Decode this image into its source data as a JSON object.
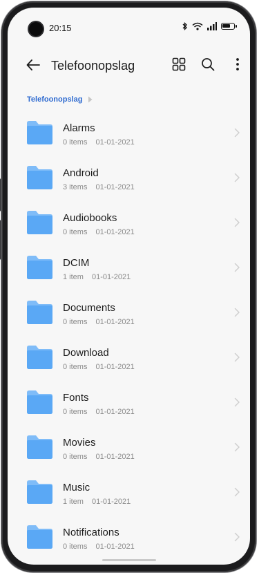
{
  "status_bar": {
    "time": "20:15",
    "icons": [
      "bluetooth-icon",
      "wifi-icon",
      "signal-icon",
      "battery-icon"
    ]
  },
  "toolbar": {
    "title": "Telefoonopslag",
    "icons": [
      "back-arrow-icon",
      "grid-view-icon",
      "search-icon",
      "more-vert-icon"
    ]
  },
  "breadcrumb": {
    "items": [
      "Telefoonopslag"
    ]
  },
  "colors": {
    "folder": "#5aa8f5",
    "folder_tab": "#7fbcf8",
    "accent": "#2f6bd0",
    "background": "#f7f7f7"
  },
  "folders": [
    {
      "name": "Alarms",
      "count": "0 items",
      "date": "01-01-2021"
    },
    {
      "name": "Android",
      "count": "3 items",
      "date": "01-01-2021"
    },
    {
      "name": "Audiobooks",
      "count": "0 items",
      "date": "01-01-2021"
    },
    {
      "name": "DCIM",
      "count": "1 item",
      "date": "01-01-2021"
    },
    {
      "name": "Documents",
      "count": "0 items",
      "date": "01-01-2021"
    },
    {
      "name": "Download",
      "count": "0 items",
      "date": "01-01-2021"
    },
    {
      "name": "Fonts",
      "count": "0 items",
      "date": "01-01-2021"
    },
    {
      "name": "Movies",
      "count": "0 items",
      "date": "01-01-2021"
    },
    {
      "name": "Music",
      "count": "1 item",
      "date": "01-01-2021"
    },
    {
      "name": "Notifications",
      "count": "0 items",
      "date": "01-01-2021"
    }
  ]
}
